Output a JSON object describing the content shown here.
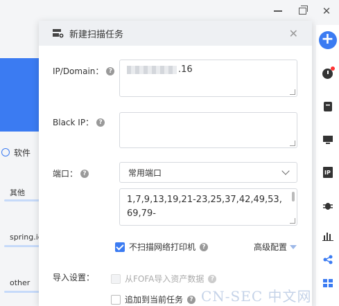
{
  "dialog": {
    "title": "新建扫描任务",
    "ip_label": "IP/Domain：",
    "ip_value_suffix": ".16",
    "black_ip_label": "Black IP：",
    "port_label": "端口：",
    "port_select_value": "常用端口",
    "port_list": "1,7,9,13,19,21-23,25,37,42,49,53,69,79-",
    "no_printer_label": "不扫描网络打印机",
    "no_printer_checked": true,
    "advanced_label": "高级配置",
    "import_label": "导入设置：",
    "import_fofa_label": "从FOFA导入资产数据",
    "append_task_label": "追加到当前任务"
  },
  "left_panel": {
    "section_label": "软件",
    "items": [
      "其他",
      "spring.ic",
      "other"
    ]
  },
  "sidebar": {
    "icons": [
      "add-icon",
      "history-icon",
      "storage-icon",
      "monitor-icon",
      "ip-icon",
      "bug-icon",
      "chart-icon",
      "share-icon",
      "grid-icon"
    ]
  },
  "watermark": "CN-SEC 中文网",
  "colors": {
    "accent": "#3b7bf2"
  }
}
